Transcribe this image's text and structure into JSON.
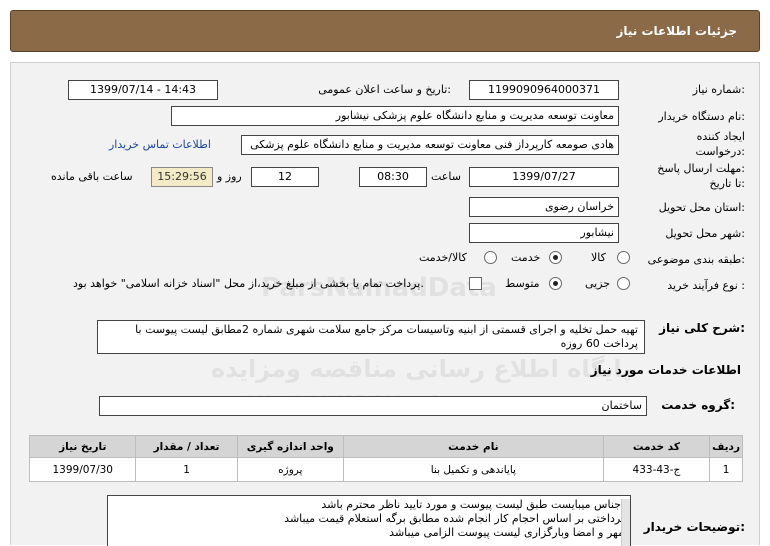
{
  "header": {
    "title": "جزئیات اطلاعات نیاز"
  },
  "fields": {
    "need_number_label": "شماره نیاز:",
    "need_number": "1199090964000371",
    "announce_label": "تاریخ و ساعت اعلان عمومی:",
    "announce_value": "1399/07/14 - 14:43",
    "buyer_org_label": "نام دستگاه خریدار:",
    "buyer_org": "معاونت توسعه مدیریت و منابع دانشگاه علوم پزشکی نیشابور",
    "creator_label_1": "ایجاد کننده",
    "creator_label_2": "درخواست:",
    "creator": "هادی صومعه کارپرداز فنی معاونت توسعه مدیریت و منابع دانشگاه علوم پزشکی",
    "contact_link": "اطلاعات تماس خریدار",
    "deadline_label_1": "مهلت ارسال پاسخ:",
    "deadline_label_2": "تا تاریخ:",
    "deadline_date": "1399/07/27",
    "time_label": "ساعت",
    "deadline_time": "08:30",
    "days_count": "12",
    "days_label": "روز و",
    "remaining_time": "15:29:56",
    "remaining_label": "ساعت باقی مانده",
    "province_label": "استان محل تحویل:",
    "province": "خراسان رضوی",
    "city_label": "شهر محل تحویل:",
    "city": "نیشابور",
    "category_label": "طبقه بندی موضوعی:",
    "category_options": [
      "کالا",
      "خدمت",
      "کالا/خدمت"
    ],
    "category_selected": "خدمت",
    "purchase_type_label": "نوع فرآیند خرید :",
    "purchase_options": [
      "جزیی",
      "متوسط"
    ],
    "purchase_selected": "متوسط",
    "payment_note": "پرداخت تمام یا بخشی از مبلغ خرید،از محل \"اسناد خزانه اسلامی\" خواهد بود.",
    "description_label": "شرح کلی نیاز:",
    "description": "تهیه حمل تخلیه و اجرای قسمتی از ابنیه وتاسیسات مرکز جامع سلامت شهری شماره 2مطابق لیست پیوست با پرداخت 60 روزه",
    "services_title": "اطلاعات خدمات مورد نیاز",
    "service_group_label": "گروه خدمت:",
    "service_group": "ساختمان",
    "buyer_notes_label": "توضیحات خریدار:",
    "buyer_notes": [
      "اجناس میبایست طبق لیست پیوست و مورد تایید ناظر محترم باشد",
      "پرداختی بر اساس احجام کار انجام شده مطابق برگه استعلام قیمت میباشد",
      "مهر و امضا وبارگزاری لیست پیوست الزامی میباشد"
    ]
  },
  "table": {
    "headers": [
      "ردیف",
      "کد خدمت",
      "نام خدمت",
      "واحد اندازه گیری",
      "تعداد / مقدار",
      "تاریخ نیاز"
    ],
    "rows": [
      [
        "1",
        "ج-43-433",
        "پایاندهی و تکمیل بنا",
        "پروژه",
        "1",
        "1399/07/30"
      ]
    ]
  },
  "watermark": {
    "line1": "ParsNamadData",
    "line2": "پایگاه اطلاع رسانی مناقصه ومزایده",
    "line3": "۰۲۱-۸۸۳۴۹۶۷۰-۵"
  },
  "colors": {
    "header_bg": "#8b6a48",
    "panel_bg": "#f2f2f2",
    "link": "#1a47a0",
    "remaining_bg": "#f2ebc6"
  }
}
